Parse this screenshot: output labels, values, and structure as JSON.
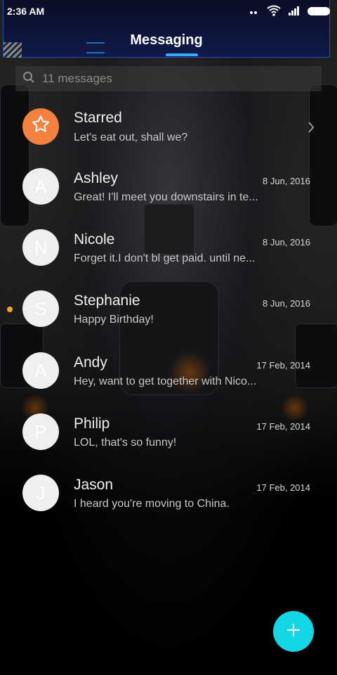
{
  "status_bar": {
    "time": "2:36 AM"
  },
  "header": {
    "title": "Messaging"
  },
  "search": {
    "placeholder": "11 messages"
  },
  "conversations": [
    {
      "name": "Starred",
      "snippet": "Let's eat out, shall we?",
      "date": "",
      "initial": "",
      "icon": "star-icon"
    },
    {
      "name": "Ashley",
      "snippet": "Great! I'll meet you downstairs in te...",
      "date": "8 Jun, 2016",
      "initial": "A"
    },
    {
      "name": "Nicole",
      "snippet": "Forget it.I don't bl get paid. until ne...",
      "date": "8 Jun, 2016",
      "initial": "N"
    },
    {
      "name": "Stephanie",
      "snippet": "Happy Birthday!",
      "date": "8 Jun, 2016",
      "initial": "S",
      "unread": true
    },
    {
      "name": "Andy",
      "snippet": "Hey, want to get together with Nico...",
      "date": "17 Feb, 2014",
      "initial": "A"
    },
    {
      "name": "Philip",
      "snippet": "LOL, that's so funny!",
      "date": "17 Feb, 2014",
      "initial": "P"
    },
    {
      "name": "Jason",
      "snippet": "I heard you're moving to China.",
      "date": "17 Feb, 2014",
      "initial": "J"
    }
  ],
  "colors": {
    "accent": "#12d6e6",
    "starred": "#f4813f",
    "unread": "#f6a623",
    "header_line": "#3aa9ff"
  },
  "fab": {
    "icon": "plus-icon"
  }
}
